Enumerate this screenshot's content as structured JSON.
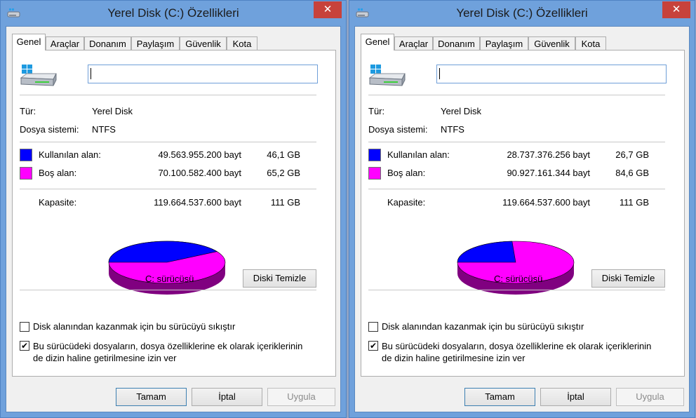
{
  "dialogs": [
    {
      "title": "Yerel Disk (C:) Özellikleri",
      "close_glyph": "✕",
      "tabs": [
        "Genel",
        "Araçlar",
        "Donanım",
        "Paylaşım",
        "Güvenlik",
        "Kota"
      ],
      "active_tab": "Genel",
      "volume_name": "",
      "type_label": "Tür:",
      "type_value": "Yerel Disk",
      "fs_label": "Dosya sistemi:",
      "fs_value": "NTFS",
      "used_label": "Kullanılan alan:",
      "used_bytes": "49.563.955.200 bayt",
      "used_size": "46,1 GB",
      "used_fraction": 0.4142,
      "free_label": "Boş alan:",
      "free_bytes": "70.100.582.400 bayt",
      "free_size": "65,2 GB",
      "capacity_label": "Kapasite:",
      "capacity_bytes": "119.664.537.600 bayt",
      "capacity_size": "111 GB",
      "drive_label": "C: sürücüsü",
      "cleanup_button": "Diski Temizle",
      "compress_label": "Disk alanından kazanmak için bu sürücüyü sıkıştır",
      "compress_checked": false,
      "index_label_line1": "Bu sürücüdeki dosyaların, dosya özelliklerine ek olarak içeriklerinin",
      "index_label_line2": "de dizin haline getirilmesine izin ver",
      "index_checked": true,
      "check_glyph": "✔",
      "ok_button": "Tamam",
      "cancel_button": "İptal",
      "apply_button": "Uygula"
    },
    {
      "title": "Yerel Disk (C:) Özellikleri",
      "close_glyph": "✕",
      "tabs": [
        "Genel",
        "Araçlar",
        "Donanım",
        "Paylaşım",
        "Güvenlik",
        "Kota"
      ],
      "active_tab": "Genel",
      "volume_name": "",
      "type_label": "Tür:",
      "type_value": "Yerel Disk",
      "fs_label": "Dosya sistemi:",
      "fs_value": "NTFS",
      "used_label": "Kullanılan alan:",
      "used_bytes": "28.737.376.256 bayt",
      "used_size": "26,7 GB",
      "used_fraction": 0.2401,
      "free_label": "Boş alan:",
      "free_bytes": "90.927.161.344 bayt",
      "free_size": "84,6 GB",
      "capacity_label": "Kapasite:",
      "capacity_bytes": "119.664.537.600 bayt",
      "capacity_size": "111 GB",
      "drive_label": "C: sürücüsü",
      "cleanup_button": "Diski Temizle",
      "compress_label": "Disk alanından kazanmak için bu sürücüyü sıkıştır",
      "compress_checked": false,
      "index_label_line1": "Bu sürücüdeki dosyaların, dosya özelliklerine ek olarak içeriklerinin",
      "index_label_line2": "de dizin haline getirilmesine izin ver",
      "index_checked": true,
      "check_glyph": "✔",
      "ok_button": "Tamam",
      "cancel_button": "İptal",
      "apply_button": "Uygula"
    }
  ],
  "colors": {
    "used": "#0000ff",
    "used_side": "#000080",
    "free": "#ff00ff",
    "free_side": "#800080",
    "titlebar": "#6fa1dc",
    "close": "#c7423b"
  }
}
